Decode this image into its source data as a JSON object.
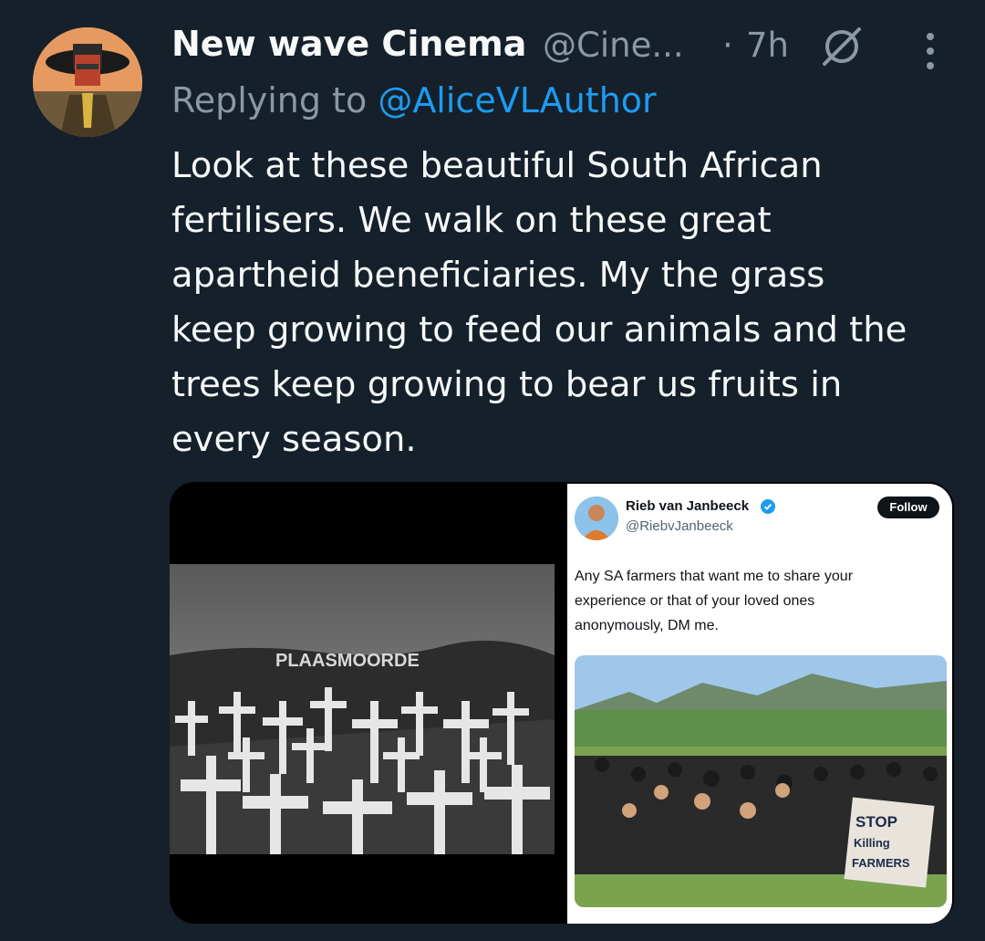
{
  "tweet": {
    "author_name": "New wave Cinema",
    "author_handle": "@Cine...",
    "separator": "·",
    "time": "7h",
    "replying_prefix": "Replying to ",
    "replying_handle": "@AliceVLAuthor",
    "body_lines": [
      "Look at these beautiful South African",
      "fertilisers. We walk on these great",
      "apartheid beneficiaries. My the grass",
      "keep growing to feed our animals and the",
      "trees keep growing to bear us fruits in",
      "every season."
    ]
  },
  "icons": {
    "avatar": "avatar-image",
    "status": "null-circle-icon",
    "more": "more-vertical-icon"
  },
  "media": {
    "image1": {
      "sign_text": "PLAASMOORDE"
    },
    "image2": {
      "name": "Rieb van Janbeeck",
      "handle": "@RiebvJanbeeck",
      "follow_label": "Follow",
      "text_lines": [
        "Any SA farmers that want me to share your",
        "experience or that of your loved ones",
        "anonymously, DM me."
      ],
      "placard_lines": [
        "STOP",
        "Killing",
        "FARMERS"
      ]
    }
  },
  "colors": {
    "background": "#15202b",
    "primary_text": "#f7f9f9",
    "secondary_text": "#8b98a5",
    "link": "#1d9bf0"
  }
}
